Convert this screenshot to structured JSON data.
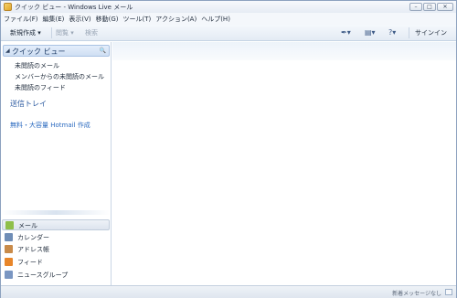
{
  "window": {
    "title": "クイック ビュー - Windows Live メール",
    "controls": [
      "–",
      "□",
      "✕"
    ]
  },
  "menubar": [
    "ファイル(F)",
    "編集(E)",
    "表示(V)",
    "移動(G)",
    "ツール(T)",
    "アクション(A)",
    "ヘルプ(H)"
  ],
  "toolbar": {
    "new_label": "新規作成 ▾",
    "reply_label": "閲覧 ▾",
    "search_label": "検索",
    "pen_icon": "✒▾",
    "layout_icon": "▤▾",
    "help_icon": "?▾",
    "signin_label": "サインイン"
  },
  "sidebar": {
    "quickview": {
      "arrow": "◢",
      "title": "クイック ビュー",
      "search_icon": "🔍",
      "items": [
        "未閲読のメール",
        "メンバーからの未閲読のメール",
        "未閲読のフィード"
      ]
    },
    "outbox": "送信トレイ",
    "hotmail_link": "無料・大容量 Hotmail 作成",
    "nav": [
      {
        "label": "メール",
        "icon": "mail-icon",
        "color": "#8fbf4a",
        "selected": true
      },
      {
        "label": "カレンダー",
        "icon": "calendar-icon",
        "color": "#6f8db6",
        "selected": false
      },
      {
        "label": "アドレス帳",
        "icon": "contacts-icon",
        "color": "#c98b4a",
        "selected": false
      },
      {
        "label": "フィード",
        "icon": "feed-icon",
        "color": "#e8862a",
        "selected": false
      },
      {
        "label": "ニュースグループ",
        "icon": "newsgroup-icon",
        "color": "#7a96c2",
        "selected": false
      }
    ]
  },
  "statusbar": {
    "text": "新着メッセージなし"
  }
}
